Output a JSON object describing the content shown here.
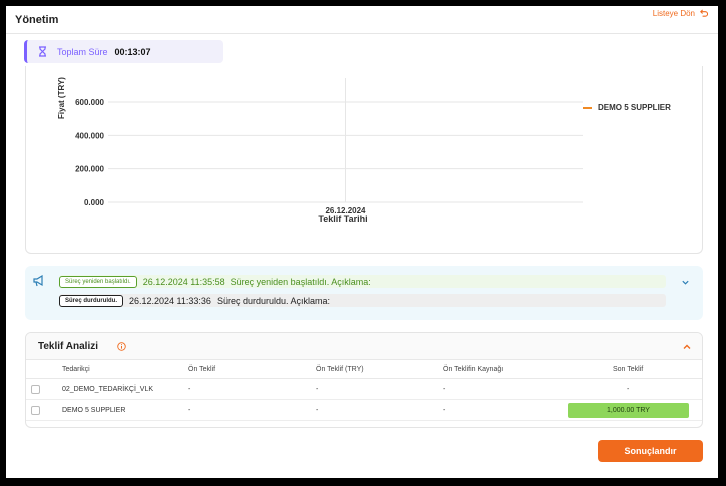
{
  "header": {
    "title": "Yönetim",
    "back_label": "Listeye Dön"
  },
  "timer": {
    "label": "Toplam Süre",
    "value": "00:13:07"
  },
  "chart_data": {
    "type": "line",
    "ylabel": "Fiyat (TRY)",
    "xlabel": "Teklif Tarihi",
    "x": [
      "26.12.2024"
    ],
    "y_ticks": [
      "0.000",
      "200.000",
      "400.000",
      "600.000"
    ],
    "series": [
      {
        "name": "DEMO 5 SUPPLIER",
        "color": "#f08a24",
        "values": []
      }
    ]
  },
  "log": {
    "entries": [
      {
        "badge": "Süreç yeniden başlatıldı.",
        "timestamp": "26.12.2024 11:35:58",
        "message": "Süreç yeniden başlatıldı. Açıklama:"
      },
      {
        "badge": "Süreç durduruldu.",
        "timestamp": "26.12.2024 11:33:36",
        "message": "Süreç durduruldu. Açıklama:"
      }
    ]
  },
  "analysis": {
    "title": "Teklif Analizi",
    "columns": [
      "Tedarikçi",
      "Ön Teklif",
      "Ön Teklif (TRY)",
      "Ön Teklifin Kaynağı",
      "Son Teklif"
    ],
    "rows": [
      {
        "supplier": "02_DEMO_TEDARİKÇİ_VLK",
        "pre_offer": "-",
        "pre_offer_try": "-",
        "source": "-",
        "last_offer": "-"
      },
      {
        "supplier": "DEMO 5 SUPPLIER",
        "pre_offer": "-",
        "pre_offer_try": "-",
        "source": "-",
        "last_offer": "1,000.00 TRY"
      }
    ]
  },
  "actions": {
    "submit_label": "Sonuçlandır"
  },
  "colors": {
    "accent": "#f06a1d",
    "timer_accent": "#7b61ff",
    "success": "#8ed65a"
  }
}
